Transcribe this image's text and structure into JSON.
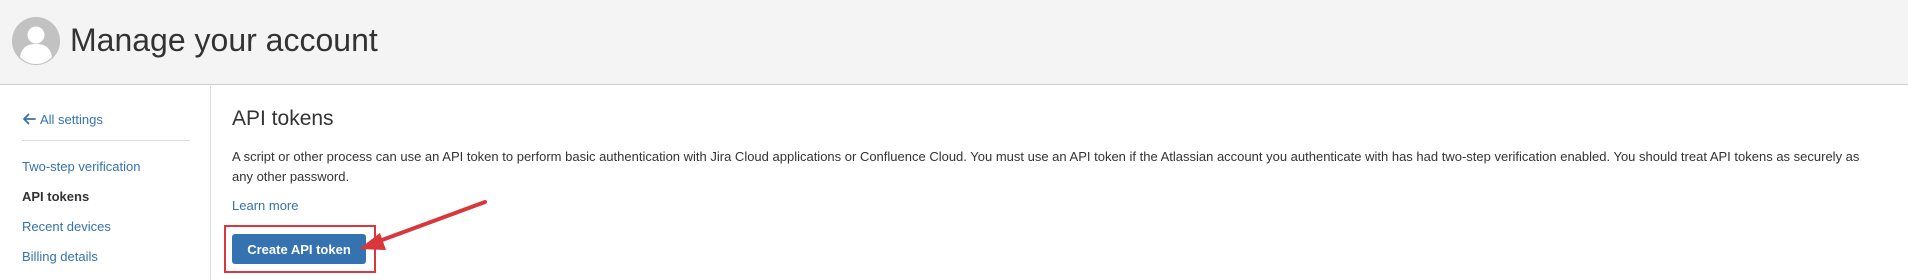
{
  "header": {
    "title": "Manage your account",
    "avatar_icon": "user-avatar-icon"
  },
  "sidebar": {
    "back_link": {
      "label": "All settings",
      "icon": "arrow-left-icon"
    },
    "items": [
      {
        "label": "Two-step verification",
        "active": false
      },
      {
        "label": "API tokens",
        "active": true
      },
      {
        "label": "Recent devices",
        "active": false
      },
      {
        "label": "Billing details",
        "active": false
      }
    ]
  },
  "main": {
    "title": "API tokens",
    "description": "A script or other process can use an API token to perform basic authentication with Jira Cloud applications or Confluence Cloud. You must use an API token if the Atlassian account you authenticate with has had two-step verification enabled. You should treat API tokens as securely as any other password.",
    "learn_more": "Learn more",
    "create_button": "Create API token"
  },
  "colors": {
    "link": "#3572b0",
    "button": "#3572b0",
    "annotation": "#d9373c",
    "header_bg": "#f4f4f4"
  }
}
